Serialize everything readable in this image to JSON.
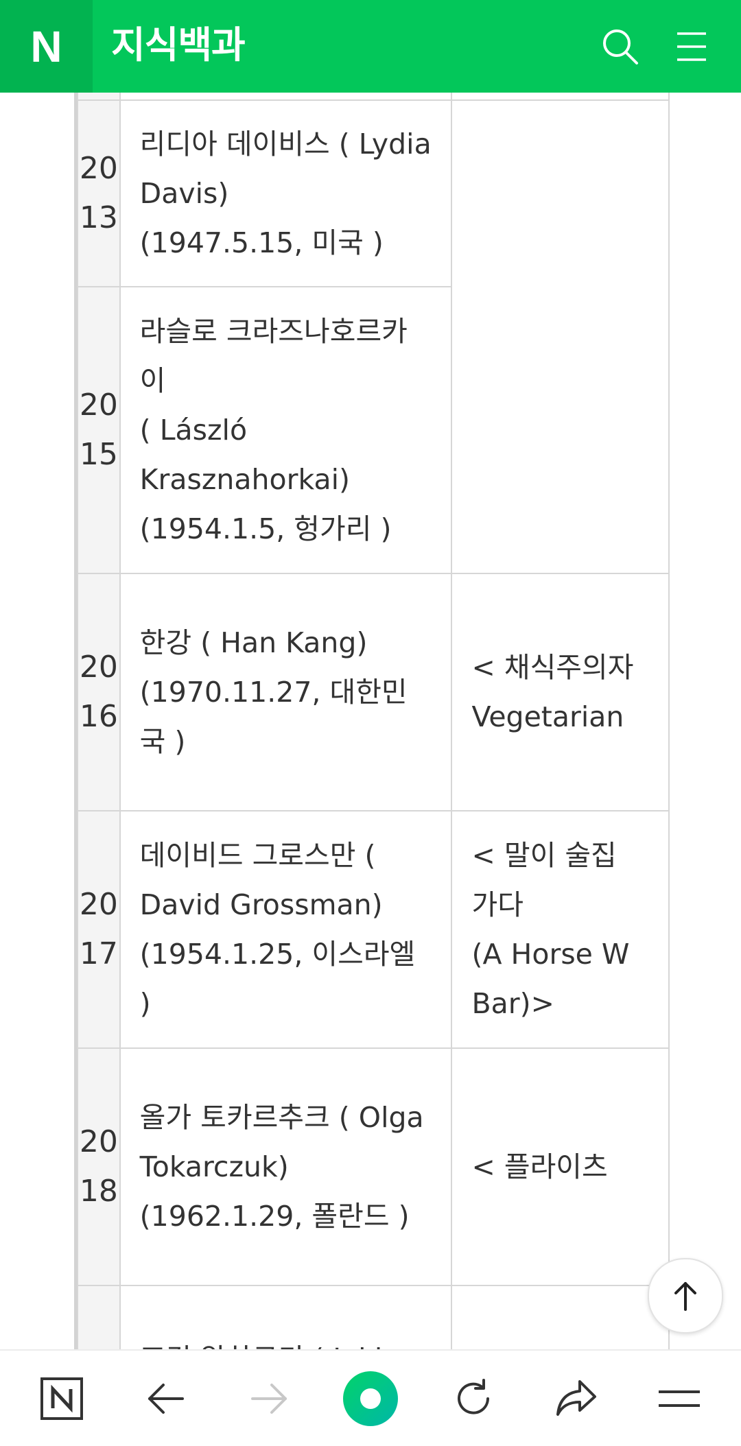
{
  "header": {
    "logo": "N",
    "title": "지식백과",
    "search_icon": "search-icon",
    "menu_icon": "hamburger-menu-icon",
    "color": "#03c75a"
  },
  "table": {
    "rows": [
      {
        "year_top": "20",
        "year_bottom": "13",
        "name_lines": [
          "리디아 데이비스 ( Lydia",
          "Davis)",
          "(1947.5.15, 미국 )"
        ],
        "work_lines": []
      },
      {
        "year_top": "20",
        "year_bottom": "15",
        "name_lines": [
          "라슬로 크라즈나호르카",
          "이",
          "( László",
          "Krasznahorkai)",
          "(1954.1.5, 헝가리 )"
        ],
        "work_lines": []
      },
      {
        "year_top": "20",
        "year_bottom": "16",
        "name_lines": [
          "한강 ( Han Kang)",
          "(1970.11.27, 대한민",
          "국 )"
        ],
        "work_lines": [
          "< 채식주의자",
          "Vegetarian"
        ]
      },
      {
        "year_top": "20",
        "year_bottom": "17",
        "name_lines": [
          "데이비드 그로스만 (",
          "David Grossman)",
          "(1954.1.25, 이스라엘",
          ")"
        ],
        "work_lines": [
          "< 말이 술집",
          "가다",
          "(A Horse W",
          "Bar)>"
        ]
      },
      {
        "year_top": "20",
        "year_bottom": "18",
        "name_lines": [
          "올가 토카르추크 ( Olga",
          "Tokarczuk)",
          "(1962.1.29, 폴란드 )"
        ],
        "work_lines": [
          "< 플라이츠"
        ]
      },
      {
        "year_top": "",
        "year_bottom": "",
        "name_lines": [
          "조킨 알하르티 ( Jokha"
        ],
        "work_lines": []
      }
    ]
  },
  "scroll_top": {
    "icon": "arrow-up-icon"
  },
  "toolbar": {
    "items": [
      {
        "icon": "naver-home-icon"
      },
      {
        "icon": "back-arrow-icon"
      },
      {
        "icon": "forward-arrow-icon"
      },
      {
        "icon": "green-dot-icon"
      },
      {
        "icon": "refresh-icon"
      },
      {
        "icon": "share-icon"
      },
      {
        "icon": "menu-icon"
      }
    ],
    "accent": "#03c75a"
  }
}
